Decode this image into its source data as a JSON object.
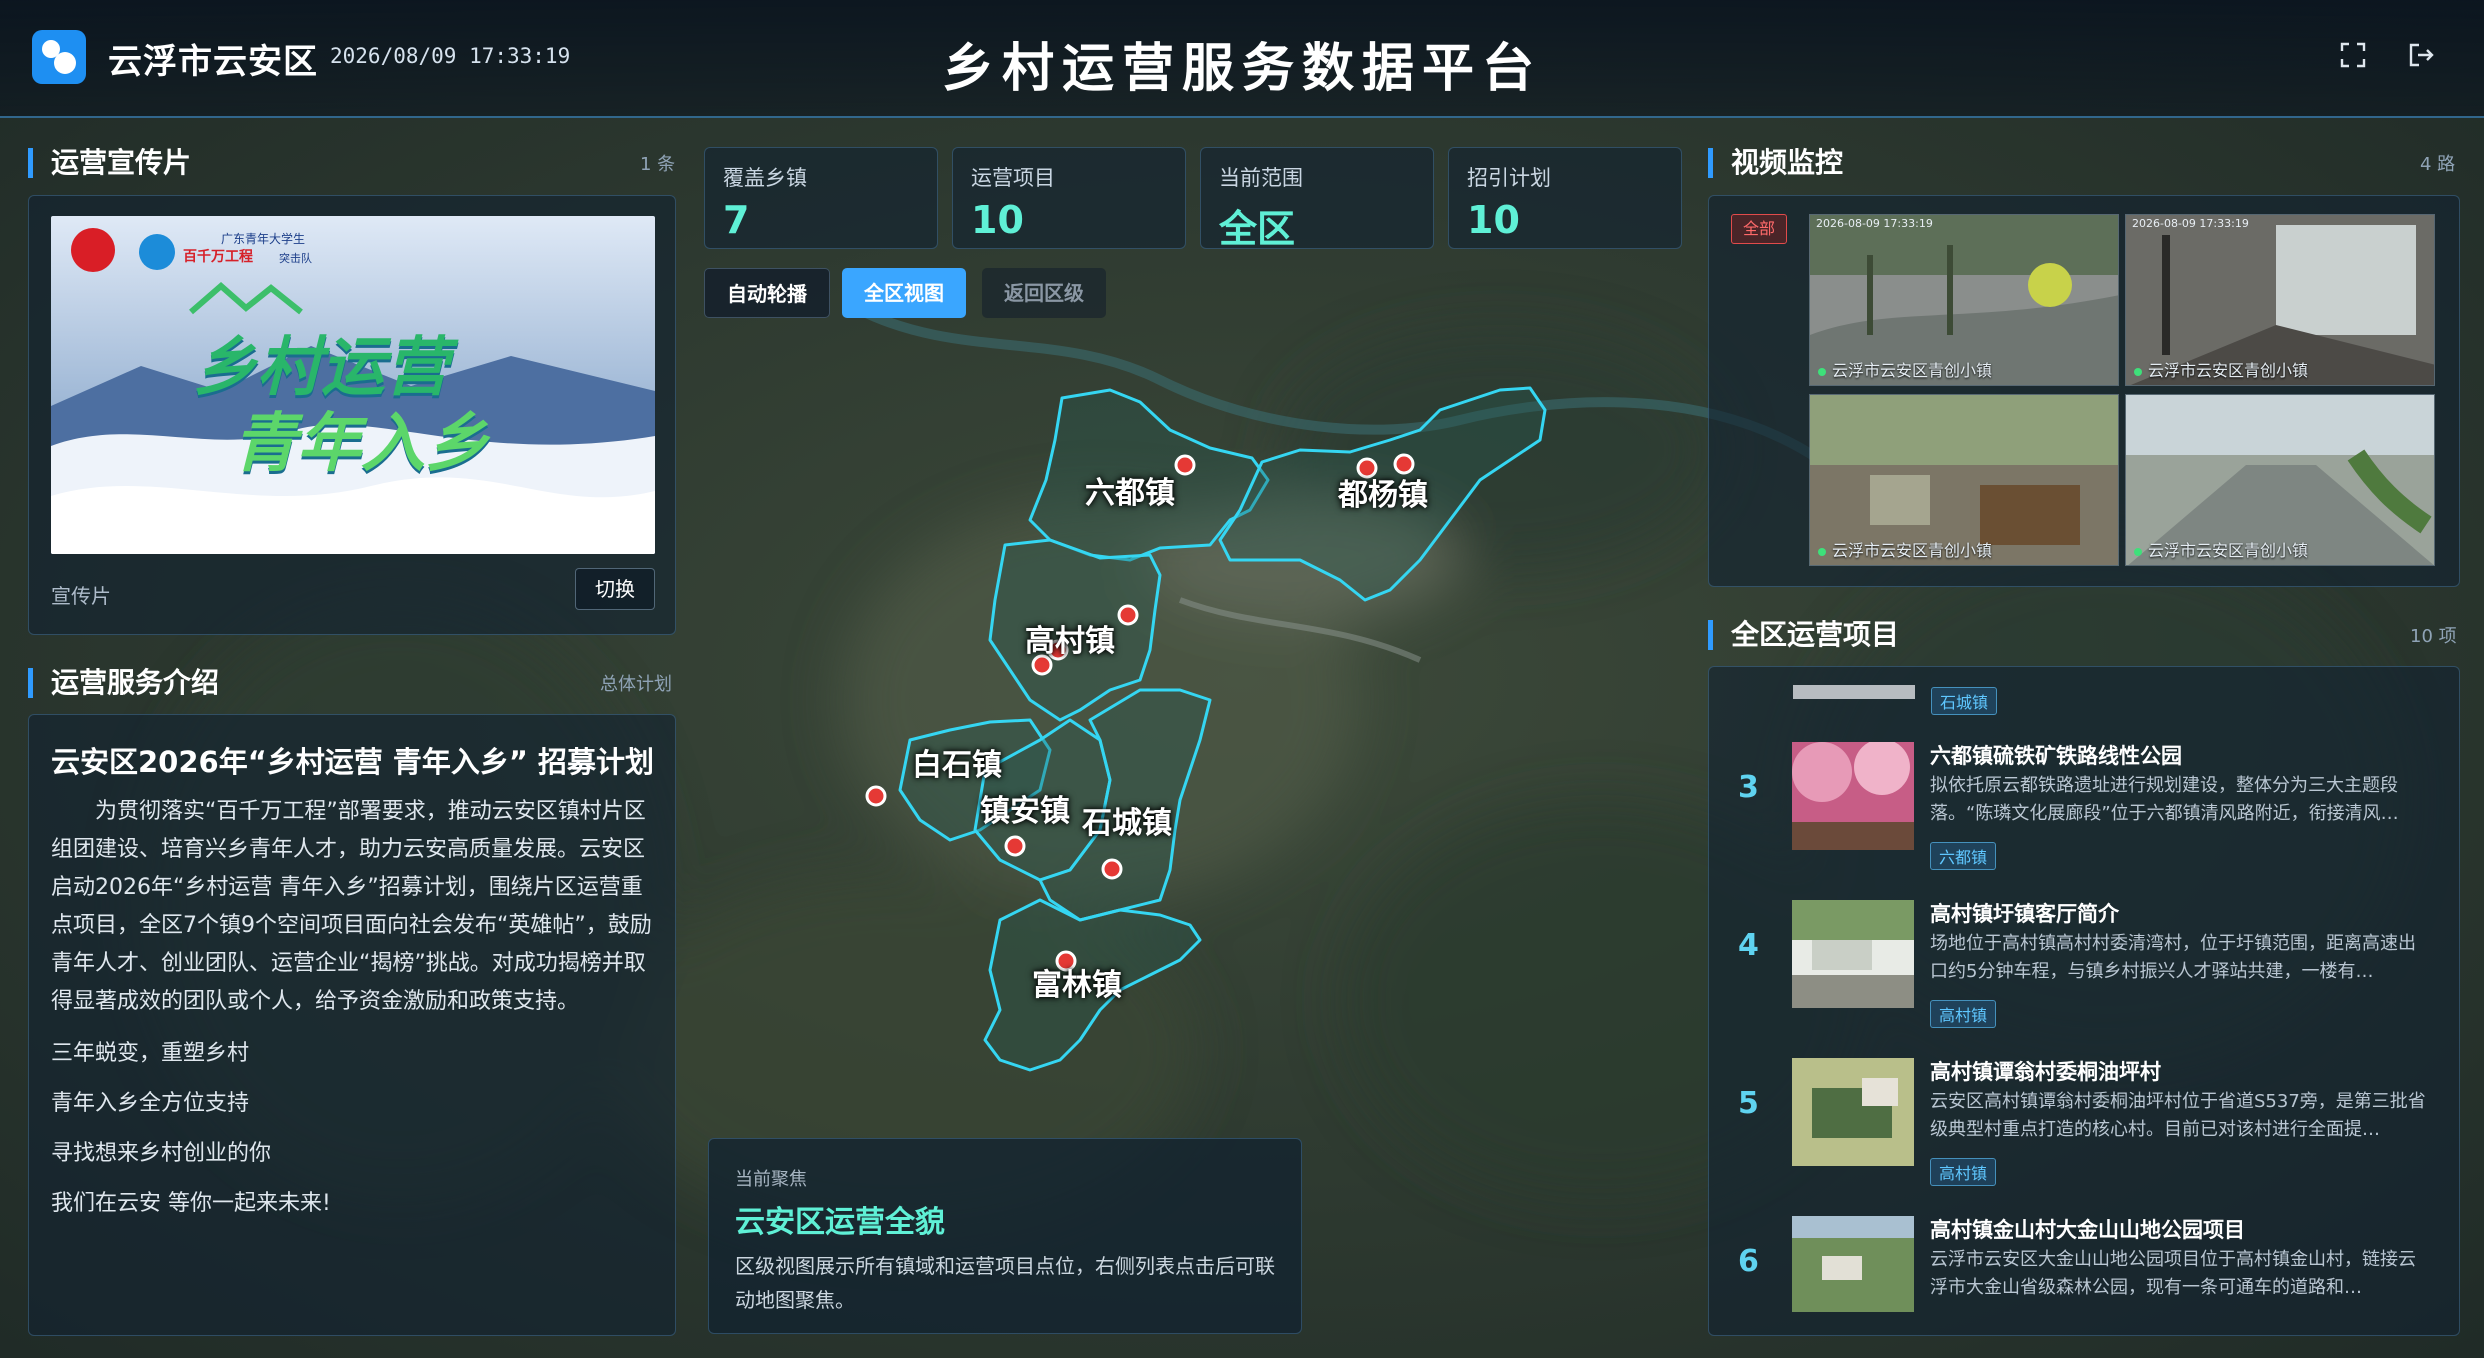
{
  "header": {
    "region": "云浮市云安区",
    "datetime": "2026/08/09 17:33:19",
    "title": "乡村运营服务数据平台",
    "icons": [
      "fullscreen-icon",
      "logout-icon"
    ]
  },
  "promo": {
    "title": "运营宣传片",
    "count": "1 条",
    "caption": "宣传片",
    "switch_label": "切换",
    "poster": {
      "org_line1": "广东青年大学生",
      "org_line2": "百千万工程",
      "org_line3": "突击队",
      "slogan_line1": "乡村运营",
      "slogan_line2": "青年入乡"
    }
  },
  "intro": {
    "title": "运营服务介绍",
    "link": "总体计划",
    "heading": "云安区2026年“乡村运营 青年入乡” 招募计划",
    "body": "为贯彻落实“百千万工程”部署要求，推动云安区镇村片区组团建设、培育兴乡青年人才，助力云安高质量发展。云安区启动2026年“乡村运营 青年入乡”招募计划，围绕片区运营重点项目，全区7个镇9个空间项目面向社会发布“英雄帖”，鼓励青年人才、创业团队、运营企业“揭榜”挑战。对成功揭榜并取得显著成效的团队或个人，给予资金激励和政策支持。",
    "lines": [
      "三年蜕变，重塑乡村",
      "青年入乡全方位支持",
      "寻找想来乡村创业的你",
      "我们在云安  等你一起来未来!"
    ]
  },
  "stats": [
    {
      "label": "覆盖乡镇",
      "value": "7"
    },
    {
      "label": "运营项目",
      "value": "10"
    },
    {
      "label": "当前范围",
      "value": "全区"
    },
    {
      "label": "招引计划",
      "value": "10"
    }
  ],
  "map_controls": {
    "auto": "自动轮播",
    "all": "全区视图",
    "back": "返回区级"
  },
  "map": {
    "towns": [
      "六都镇",
      "都杨镇",
      "高村镇",
      "白石镇",
      "镇安镇",
      "石城镇",
      "富林镇"
    ]
  },
  "focus": {
    "label": "当前聚焦",
    "title": "云安区运营全貌",
    "desc": "区级视图展示所有镇域和运营项目点位，右侧列表点击后可联动地图聚焦。"
  },
  "video": {
    "title": "视频监控",
    "count": "4 路",
    "filter": "全部",
    "feeds": [
      {
        "label": "云浮市云安区青创小镇",
        "stamp": "2026-08-09 17:33:19"
      },
      {
        "label": "云浮市云安区青创小镇",
        "stamp": "2026-08-09 17:33:19"
      },
      {
        "label": "云浮市云安区青创小镇",
        "stamp": ""
      },
      {
        "label": "云浮市云安区青创小镇",
        "stamp": ""
      }
    ]
  },
  "projects": {
    "title": "全区运营项目",
    "count": "10 项",
    "partial_tag": "石城镇",
    "items": [
      {
        "num": "3",
        "title": "六都镇硫铁矿铁路线性公园",
        "desc": "拟依托原云都铁路遗址进行规划建设，整体分为三大主题段落。“陈璘文化展廊段”位于六都镇清风路附近，衔接清风…",
        "tag": "六都镇"
      },
      {
        "num": "4",
        "title": "高村镇圩镇客厅简介",
        "desc": "场地位于高村镇高村村委清湾村，位于圩镇范围，距离高速出口约5分钟车程，与镇乡村振兴人才驿站共建，一楼有…",
        "tag": "高村镇"
      },
      {
        "num": "5",
        "title": "高村镇谭翁村委桐油坪村",
        "desc": "云安区高村镇谭翁村委桐油坪村位于省道S537旁，是第三批省级典型村重点打造的核心村。目前已对该村进行全面提…",
        "tag": "高村镇"
      },
      {
        "num": "6",
        "title": "高村镇金山村大金山山地公园项目",
        "desc": "云浮市云安区大金山山地公园项目位于高村镇金山村，链接云浮市大金山省级森林公园，现有一条可通车的道路和…",
        "tag": "高村镇"
      }
    ]
  },
  "colors": {
    "accent": "#2f9bff",
    "stat": "#5ff0d6",
    "boundary": "#35d6f2",
    "pin": "#e53935"
  }
}
